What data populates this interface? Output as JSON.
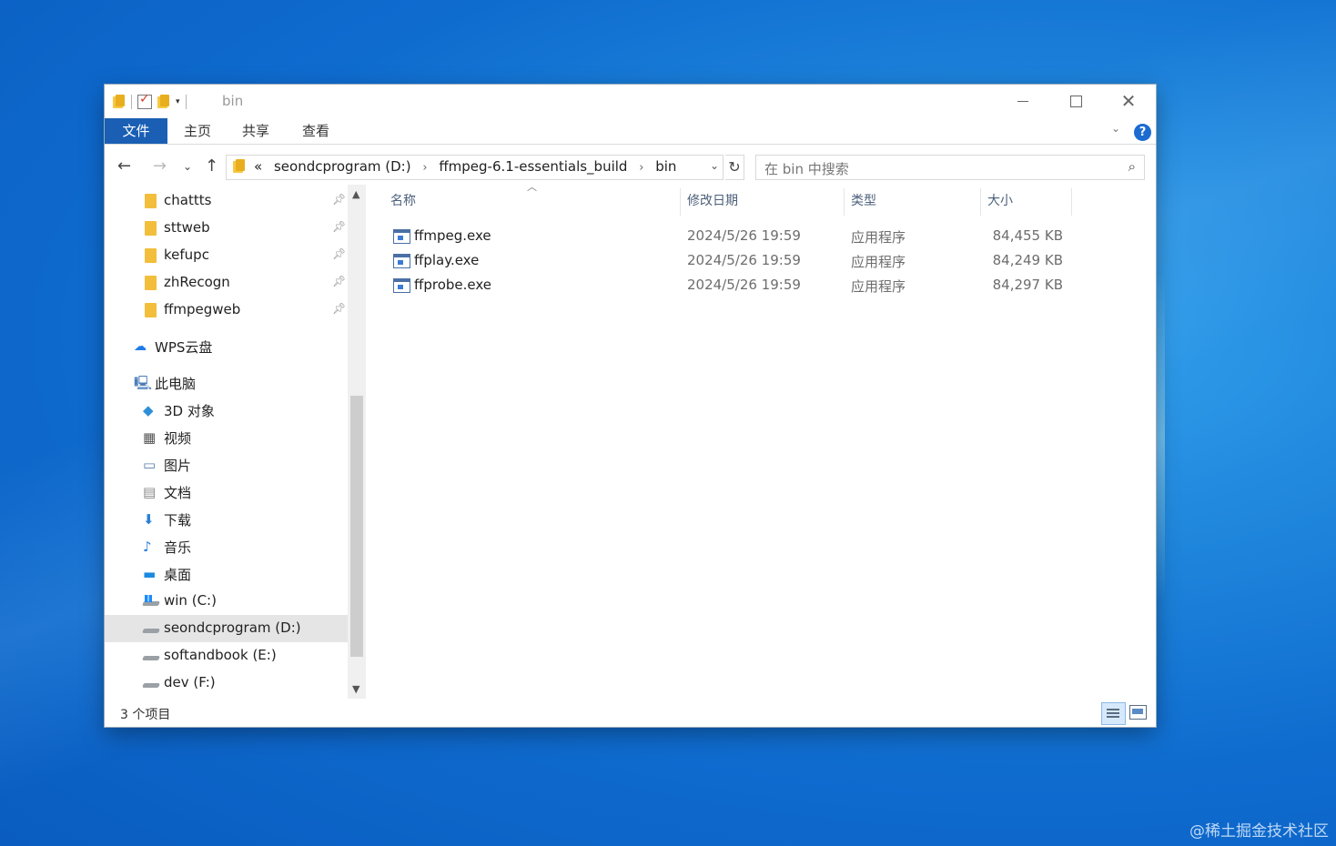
{
  "window": {
    "title": "bin",
    "controls": {
      "minimize": "minimize-icon",
      "maximize": "maximize-icon",
      "close": "close-icon"
    }
  },
  "ribbon": {
    "tabs": [
      "文件",
      "主页",
      "共享",
      "查看"
    ],
    "help_label": "?"
  },
  "nav": {
    "back_icon": "←",
    "forward_icon": "→",
    "recent_icon": "⌄",
    "up_icon": "↑",
    "breadcrumb_overflow": "«",
    "breadcrumb": [
      "seondcprogram (D:)",
      "ffmpeg-6.1-essentials_build",
      "bin"
    ],
    "refresh_icon": "↻",
    "search_placeholder": "在 bin 中搜索",
    "search_icon": "⌕"
  },
  "sidebar": {
    "quick_access": [
      {
        "label": "chattts",
        "pinned": true
      },
      {
        "label": "sttweb",
        "pinned": true
      },
      {
        "label": "kefupc",
        "pinned": true
      },
      {
        "label": "zhRecogn",
        "pinned": true
      },
      {
        "label": "ffmpegweb",
        "pinned": true
      }
    ],
    "cloud": {
      "label": "WPS云盘",
      "icon": "cloud-icon"
    },
    "this_pc": {
      "label": "此电脑",
      "icon": "computer-icon"
    },
    "pc_items": [
      {
        "label": "3D 对象",
        "icon": "cube-icon",
        "glyph": "◆"
      },
      {
        "label": "视频",
        "icon": "film-icon",
        "glyph": "▦"
      },
      {
        "label": "图片",
        "icon": "picture-icon",
        "glyph": "▭"
      },
      {
        "label": "文档",
        "icon": "document-icon",
        "glyph": "▤"
      },
      {
        "label": "下载",
        "icon": "download-icon",
        "glyph": "⬇"
      },
      {
        "label": "音乐",
        "icon": "music-icon",
        "glyph": "♪"
      },
      {
        "label": "桌面",
        "icon": "desktop-icon",
        "glyph": "▬"
      }
    ],
    "drives": [
      {
        "label": "win (C:)",
        "selected": false
      },
      {
        "label": "seondcprogram (D:)",
        "selected": true
      },
      {
        "label": "softandbook (E:)",
        "selected": false
      },
      {
        "label": "dev (F:)",
        "selected": false
      }
    ]
  },
  "files": {
    "columns": [
      "名称",
      "修改日期",
      "类型",
      "大小"
    ],
    "rows": [
      {
        "name": "ffmpeg.exe",
        "date": "2024/5/26 19:59",
        "type": "应用程序",
        "size": "84,455 KB"
      },
      {
        "name": "ffplay.exe",
        "date": "2024/5/26 19:59",
        "type": "应用程序",
        "size": "84,249 KB"
      },
      {
        "name": "ffprobe.exe",
        "date": "2024/5/26 19:59",
        "type": "应用程序",
        "size": "84,297 KB"
      }
    ]
  },
  "status": {
    "item_count": "3 个项目"
  },
  "watermark": "@稀土掘金技术社区"
}
